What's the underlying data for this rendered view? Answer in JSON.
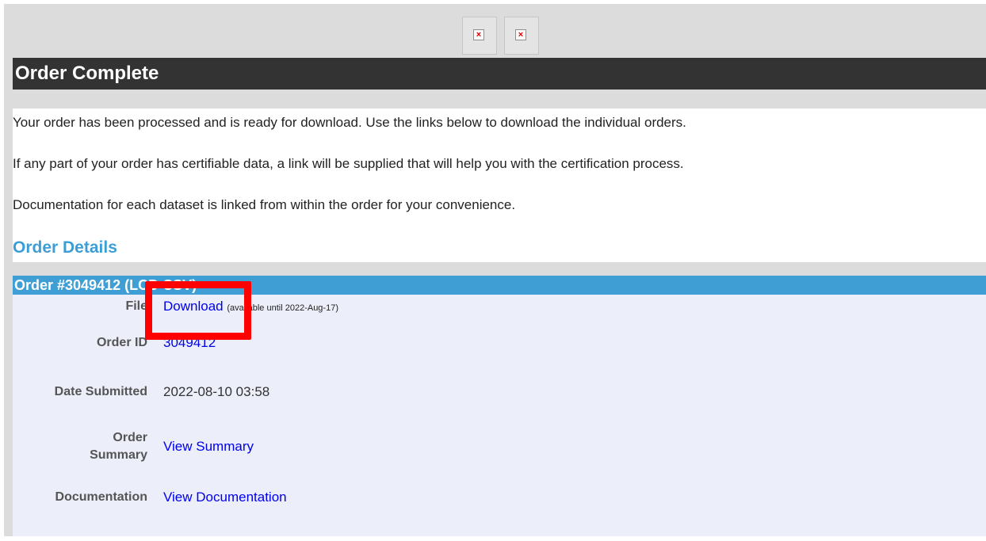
{
  "header": {
    "broken_images": [
      "broken-image-icon",
      "broken-image-icon"
    ],
    "title": "Order Complete"
  },
  "intro": {
    "line1": "Your order has been processed and is ready for download. Use the links below to download the individual orders.",
    "line2": "If any part of your order has certifiable data, a link will be supplied that will help you with the certification process.",
    "line3": "Documentation for each dataset is linked from within the order for your convenience."
  },
  "details": {
    "heading": "Order Details",
    "order_header": "Order #3049412 (LCD CSV)",
    "rows": {
      "file_label": "File",
      "file_link": "Download",
      "file_note": "(available until 2022-Aug-17)",
      "order_id_label": "Order ID",
      "order_id_value": "3049412",
      "date_label": "Date Submitted",
      "date_value": "2022-08-10 03:58",
      "summary_label_1": "Order",
      "summary_label_2": "Summary",
      "summary_link": "View Summary",
      "doc_label": "Documentation",
      "doc_link": "View Documentation"
    }
  },
  "colors": {
    "title_bar": "#333333",
    "heading": "#3d9ed6",
    "order_header": "#3f9fd5",
    "highlight": "#ff0000",
    "link": "#0000ee"
  }
}
